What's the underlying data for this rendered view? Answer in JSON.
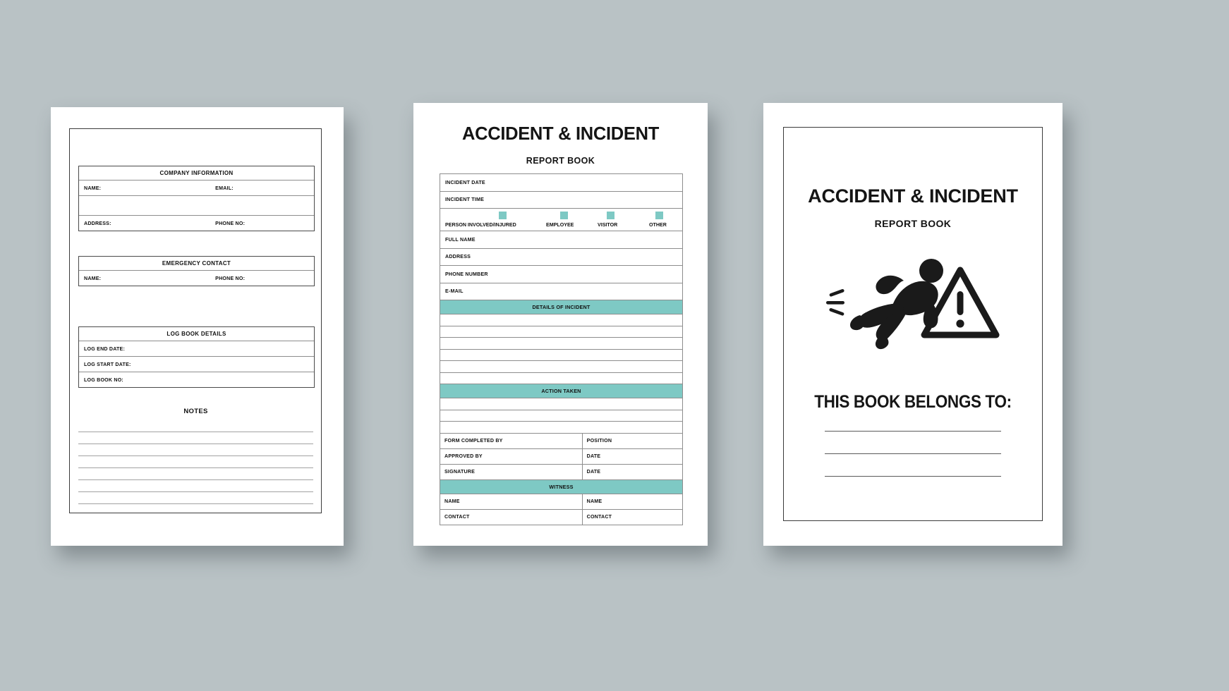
{
  "canvas": {
    "background_color": "#b9c2c5",
    "accent_teal": "#7ec9c4",
    "ink": "#141414"
  },
  "page1": {
    "company_information": {
      "title": "COMPANY INFORMATION",
      "rows": [
        {
          "left": "NAME:",
          "right": "EMAIL:"
        },
        {
          "left": "",
          "right": ""
        },
        {
          "left": "ADDRESS:",
          "right": "PHONE NO:"
        }
      ]
    },
    "emergency_contact": {
      "title": "EMERGENCY CONTACT",
      "rows": [
        {
          "left": "NAME:",
          "right": "PHONE NO:"
        }
      ]
    },
    "log_book_details": {
      "title": "LOG BOOK DETAILS",
      "rows": [
        "LOG END DATE:",
        "LOG START DATE:",
        "LOG BOOK NO:"
      ]
    },
    "notes": {
      "title": "NOTES",
      "line_count": 7
    }
  },
  "page2": {
    "title": "ACCIDENT & INCIDENT",
    "subtitle": "REPORT BOOK",
    "top_fields": [
      "INCIDENT DATE",
      "INCIDENT TIME"
    ],
    "person_row": {
      "label": "PERSON INVOLVED/INJURED",
      "options": [
        "EMPLOYEE",
        "VISITOR",
        "OTHER"
      ],
      "checkbox_color": "#7ec9c4"
    },
    "identity_fields": [
      "FULL NAME",
      "ADDRESS",
      "PHONE NUMBER",
      "E-MAIL"
    ],
    "details_of_incident": {
      "title": "DETAILS OF INCIDENT",
      "line_count": 6
    },
    "action_taken": {
      "title": "ACTION TAKEN",
      "line_count": 3
    },
    "signoff_rows": [
      {
        "left": "FORM COMPLETED BY",
        "right": "POSITION"
      },
      {
        "left": "APPROVED BY",
        "right": "DATE"
      },
      {
        "left": "SIGNATURE",
        "right": "DATE"
      }
    ],
    "witness": {
      "title": "WITNESS",
      "rows": [
        {
          "left": "NAME",
          "right": "NAME"
        },
        {
          "left": "CONTACT",
          "right": "CONTACT"
        }
      ]
    }
  },
  "page3": {
    "title": "ACCIDENT & INCIDENT",
    "subtitle": "REPORT BOOK",
    "artwork": "slip-and-fall-warning-icon",
    "belongs_to": "THIS BOOK BELONGS TO:",
    "signature_line_count": 3
  }
}
